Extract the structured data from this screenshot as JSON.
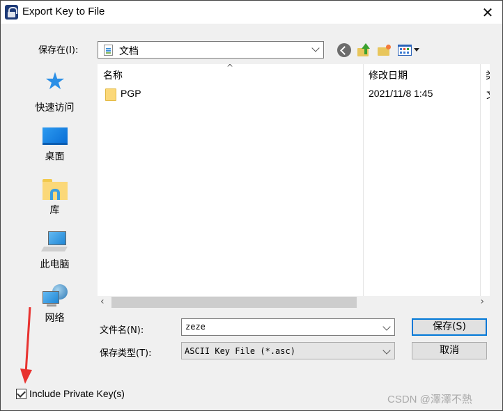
{
  "window": {
    "title": "Export Key to File",
    "close_label": "✕"
  },
  "toolbar": {
    "save_in_label": "保存在(I):",
    "save_in_value": "文档",
    "icons": [
      "back-icon",
      "up-folder-icon",
      "new-folder-icon",
      "view-menu-icon"
    ]
  },
  "places": [
    {
      "label": "快速访问",
      "icon": "quick-access-star-icon"
    },
    {
      "label": "桌面",
      "icon": "desktop-icon"
    },
    {
      "label": "库",
      "icon": "library-icon"
    },
    {
      "label": "此电脑",
      "icon": "this-pc-icon"
    },
    {
      "label": "网络",
      "icon": "network-icon"
    }
  ],
  "filelist": {
    "columns": [
      "名称",
      "修改日期",
      "类"
    ],
    "sort_indicator": "^",
    "rows": [
      {
        "name": "PGP",
        "modified": "2021/11/8 1:45",
        "type_cut": "文"
      }
    ]
  },
  "hscroll": {
    "left": "‹",
    "right": "›"
  },
  "form": {
    "filename_label": "文件名(N):",
    "filename_value": "zeze",
    "filetype_label": "保存类型(T):",
    "filetype_value": "ASCII Key File (*.asc)",
    "save_button": "保存(S)",
    "cancel_button": "取消"
  },
  "options": {
    "include_private_label": "Include Private Key(s)",
    "include_private_checked": true
  },
  "watermark": "CSDN @澤澤不熱"
}
